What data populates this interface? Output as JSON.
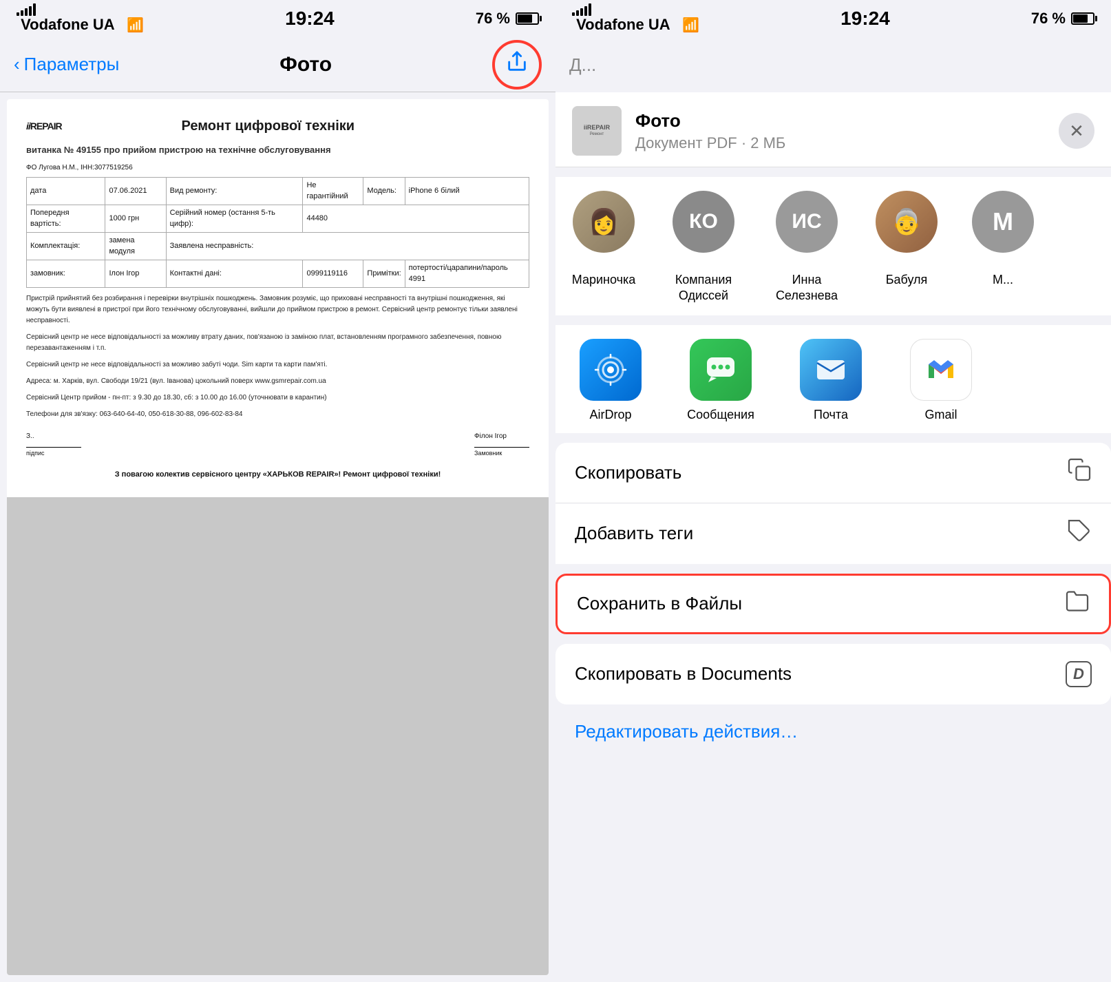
{
  "left": {
    "statusBar": {
      "carrier": "Vodafone UA",
      "time": "19:24",
      "battery": "76 %"
    },
    "navBar": {
      "backLabel": "Параметры",
      "title": "Фото"
    },
    "doc": {
      "logoText": "iiREPAIR",
      "mainTitle": "Ремонт цифрової техніки",
      "subtitle": "витанка № 49155 про прийом пристрою на технічне обслуговування",
      "orgLine": "ФО Лугова Н.М., ІНН:3077519256",
      "dateLabel": "дата",
      "dateValue": "07.06.2021",
      "repairTypeLabel": "Вид ремонту:",
      "repairTypeValue": "Не гарантійний",
      "modelLabel": "Модель:",
      "modelValue": "iPhone 6 білий",
      "prevCostLabel": "Попередня вартість:",
      "prevCostValue": "1000 грн",
      "serialLabel": "Серійний номер (остання 5-ть цифр):",
      "serialValue": "44480",
      "completenessLabel": "Комплектація:",
      "completenessValue": "замена модуля",
      "defectLabel": "Заявлена несправність:",
      "ownerLabel": "замовник:",
      "ownerValue": "Ілон Ігор",
      "contactLabel": "Контактні дані:",
      "contactValue": "0999119116",
      "notesLabel": "Примітки:",
      "notesValue": "потертості/царапини/пароль 4991",
      "bodyText": "Пристрій прийнятий без розбирання і перевірки внутрішніх пошкоджень. Замовник розуміє, що приховані несправності та внутрішні пошкодження, які можуть бути виявлені в пристрої при його технічному обслуговуванні, вийшли до приймом пристрою в ремонт. Сервісний центр ремонтує тільки заявлені несправності.",
      "bodyText2": "Сервісний центр не несе відповідальності за можливу втрату даних, пов'язаною із заміною плат, встановленням програмного забезпечення, повною перезавантаженням і т.п.",
      "bodyText3": "Сервісний центр не несе відповідальності за можливо забуті чоди. Sim карти та карти пам'яті.",
      "addressLine": "Адреса: м. Харків, вул. Свободи 19/21 (вул. Іванова) цокольний поверх www.gsmrepair.com.ua",
      "phoneLine": "Сервісний Центр прийом - пн-пт: з 9.30 до 18.30, сб: з 10.00 до 16.00 (уточнювати в карантин)",
      "phoneLine2": "Телефони для зв'язку: 063-640-64-40, 050-618-30-88, 096-602-83-84",
      "footerText": "З повагою колектив сервісного центру «ХАРЬКОВ REPAIR»! Ремонт цифрової техніки!"
    }
  },
  "right": {
    "statusBar": {
      "carrier": "Vodafone UA",
      "time": "19:24",
      "battery": "76 %"
    },
    "sheet": {
      "fileName": "Фото",
      "fileMeta": "Документ PDF · 2 МБ",
      "closeLabel": "✕"
    },
    "contacts": [
      {
        "name": "Мариночка",
        "initials": "",
        "bgColor": "#c8a070",
        "isPhoto": true
      },
      {
        "name": "Компания Одиссей",
        "initials": "КО",
        "bgColor": "#8a8a8a"
      },
      {
        "name": "Инна Селезнева",
        "initials": "ИС",
        "bgColor": "#9a9a9a"
      },
      {
        "name": "Бабуля",
        "initials": "",
        "bgColor": "#b07050",
        "isPhoto": true
      },
      {
        "name": "М...",
        "initials": "М",
        "bgColor": "#888"
      }
    ],
    "apps": [
      {
        "name": "AirDrop",
        "iconType": "airdrop"
      },
      {
        "name": "Сообщения",
        "iconType": "messages"
      },
      {
        "name": "Почта",
        "iconType": "mail"
      },
      {
        "name": "Gmail",
        "iconType": "gmail"
      }
    ],
    "actions": [
      {
        "label": "Скопировать",
        "icon": "📋",
        "highlight": false
      },
      {
        "label": "Добавить теги",
        "icon": "🏷",
        "highlight": false
      }
    ],
    "saveToPDF": {
      "label": "Сохранить в Файлы",
      "icon": "🗂"
    },
    "copyToDocs": {
      "label": "Скопировать в Documents",
      "icon": "D"
    },
    "editActionsLabel": "Редактировать действия…"
  }
}
